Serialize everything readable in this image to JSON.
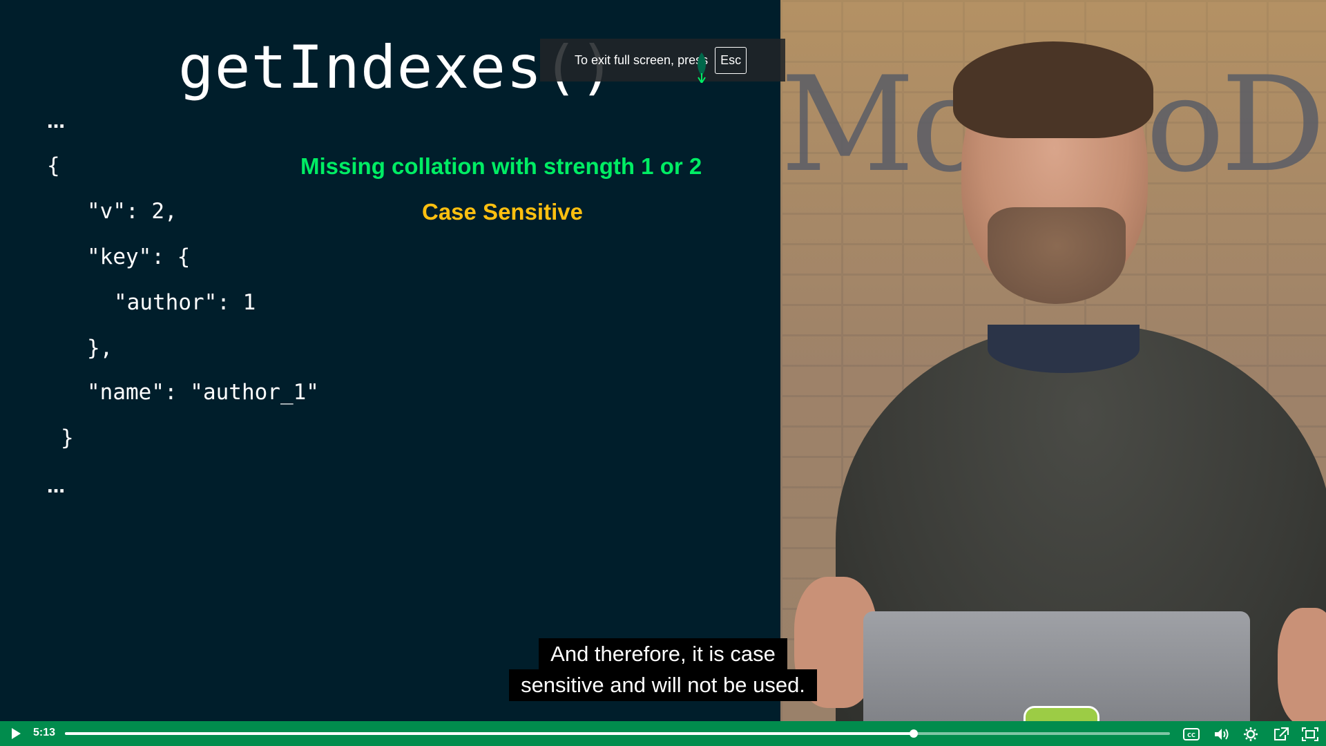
{
  "slide": {
    "title": "getIndexes()",
    "ellipsis_top": "…",
    "ellipsis_bottom": "…",
    "code": [
      "{",
      "\"v\": 2,",
      "\"key\": {",
      "\"author\": 1",
      "},",
      "\"name\": \"author_1\"",
      "}"
    ],
    "note_green": "Missing collation with strength 1 or 2",
    "note_orange": "Case Sensitive"
  },
  "scene": {
    "wall_logo": "MongoD"
  },
  "fullscreen_notice": {
    "text": "To exit full screen, press",
    "key": "Esc"
  },
  "captions": {
    "line1": "And therefore, it is case",
    "line2": "sensitive and will not be used."
  },
  "player": {
    "current_time": "5:13",
    "progress_fraction": 0.768,
    "accent_color": "#018c4d"
  },
  "icons": {
    "play": "play-icon",
    "captions": "closed-captions-icon",
    "volume": "volume-icon",
    "settings": "settings-gear-icon",
    "popout": "popout-icon",
    "fullscreen": "exit-fullscreen-icon"
  }
}
